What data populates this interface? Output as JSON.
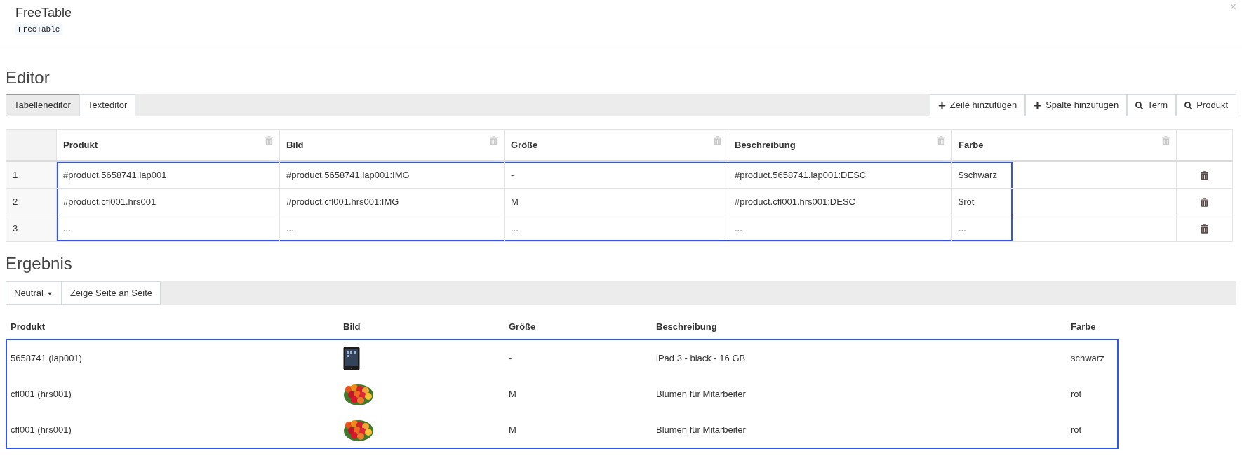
{
  "dialog": {
    "title": "FreeTable",
    "code": "FreeTable",
    "close": "×"
  },
  "editor": {
    "heading": "Editor",
    "tabs": [
      {
        "label": "Tabelleneditor",
        "selected": true
      },
      {
        "label": "Texteditor",
        "selected": false
      }
    ],
    "actions": [
      {
        "label": "Zeile hinzufügen",
        "kind": "add"
      },
      {
        "label": "Spalte hinzufügen",
        "kind": "add"
      },
      {
        "label": "Term",
        "kind": "search"
      },
      {
        "label": "Produkt",
        "kind": "search"
      }
    ],
    "table": {
      "columns": [
        "Produkt",
        "Bild",
        "Größe",
        "Beschreibung",
        "Farbe"
      ],
      "selection_frame": true,
      "rows": [
        {
          "number": "1",
          "cells": [
            "#product.5658741.lap001",
            "#product.5658741.lap001:IMG",
            "-",
            "#product.5658741.lap001:DESC",
            "$schwarz"
          ]
        },
        {
          "number": "2",
          "cells": [
            "#product.cfl001.hrs001",
            "#product.cfl001.hrs001:IMG",
            "M",
            "#product.cfl001.hrs001:DESC",
            "$rot"
          ]
        },
        {
          "number": "3",
          "cells": [
            "...",
            "...",
            "...",
            "...",
            "..."
          ]
        }
      ]
    }
  },
  "result": {
    "heading": "Ergebnis",
    "view_menu": {
      "label": "Neutral"
    },
    "side_by_side": {
      "label": "Zeige Seite an Seite"
    },
    "table": {
      "columns": [
        "Produkt",
        "Bild",
        "Größe",
        "Beschreibung",
        "Farbe"
      ],
      "selection_frame": true,
      "rows": [
        {
          "produkt": "5658741 (lap001)",
          "kind": "tablet",
          "groesse": "-",
          "beschreibung": "iPad 3 - black - 16 GB",
          "farbe": "schwarz"
        },
        {
          "produkt": "cfl001 (hrs001)",
          "kind": "flowers",
          "groesse": "M",
          "beschreibung": "Blumen für Mitarbeiter",
          "farbe": "rot"
        },
        {
          "produkt": "cfl001 (hrs001)",
          "kind": "flowers",
          "groesse": "M",
          "beschreibung": "Blumen für Mitarbeiter",
          "farbe": "rot"
        }
      ]
    }
  }
}
